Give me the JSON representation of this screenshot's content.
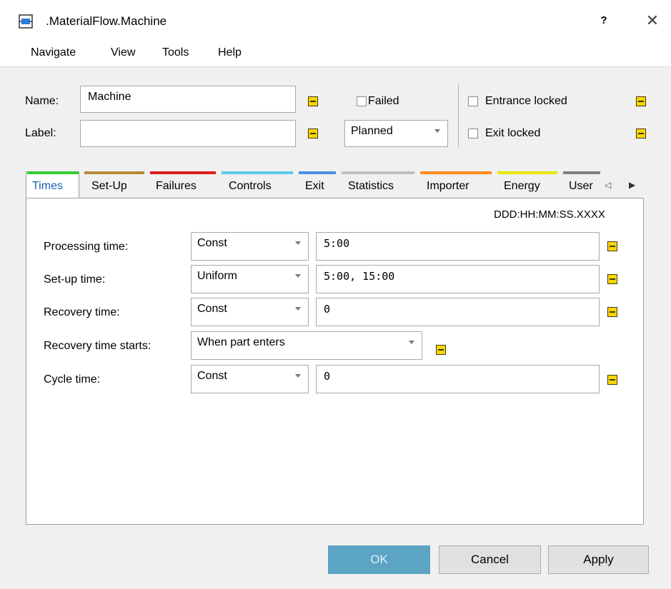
{
  "window": {
    "title": ".MaterialFlow.Machine",
    "help_label": "?",
    "close_label": "✕"
  },
  "menu": [
    "Navigate",
    "View",
    "Tools",
    "Help"
  ],
  "header": {
    "name_label": "Name:",
    "name_value": "Machine",
    "label_label": "Label:",
    "label_value": "",
    "failed_label": "Failed",
    "failed_checked": false,
    "planned_value": "Planned",
    "entrance_locked_label": "Entrance locked",
    "entrance_locked_checked": false,
    "exit_locked_label": "Exit locked",
    "exit_locked_checked": false
  },
  "tabs": [
    {
      "label": "Times",
      "color": "#33cc33",
      "active": true
    },
    {
      "label": "Set-Up",
      "color": "#b8893a"
    },
    {
      "label": "Failures",
      "color": "#e01b1b"
    },
    {
      "label": "Controls",
      "color": "#5bc8ec"
    },
    {
      "label": "Exit",
      "color": "#4a90e2"
    },
    {
      "label": "Statistics",
      "color": "#c0c0c0"
    },
    {
      "label": "Importer",
      "color": "#ff8c1a"
    },
    {
      "label": "Energy",
      "color": "#e6e600"
    },
    {
      "label": "User",
      "color": "#808080"
    }
  ],
  "times": {
    "format_hint": "DDD:HH:MM:SS.XXXX",
    "rows": [
      {
        "label": "Processing time:",
        "dist": "Const",
        "value": "5:00"
      },
      {
        "label": "Set-up time:",
        "dist": "Uniform",
        "value": "5:00, 15:00"
      },
      {
        "label": "Recovery time:",
        "dist": "Const",
        "value": "0"
      },
      {
        "label": "Recovery time starts:",
        "dist": "When part enters"
      },
      {
        "label": "Cycle time:",
        "dist": "Const",
        "value": "0"
      }
    ]
  },
  "buttons": {
    "ok": "OK",
    "cancel": "Cancel",
    "apply": "Apply"
  },
  "colors": {
    "ok_button": "#5ba4c4",
    "inherit_button": "#ffd500"
  }
}
